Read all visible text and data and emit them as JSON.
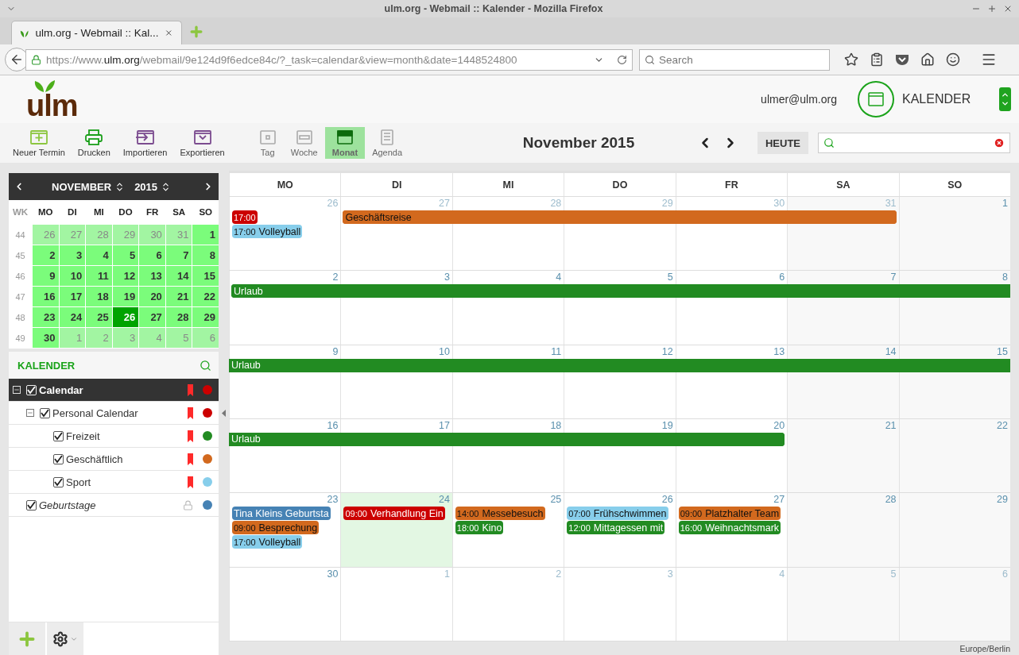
{
  "browser": {
    "window_title": "ulm.org - Webmail :: Kalender - Mozilla Firefox",
    "tab_title": "ulm.org - Webmail :: Kal...",
    "url": {
      "scheme": "https://www.",
      "domain": "ulm.org",
      "path": "/webmail/9e124d9f6edce84c/?_task=calendar&view=month&date=1448524800"
    },
    "search": {
      "placeholder": "Search"
    }
  },
  "header": {
    "logo": "ulm",
    "user": "ulmer@ulm.org",
    "app": "KALENDER"
  },
  "toolbar": {
    "actions": [
      {
        "label": "Neuer Termin"
      },
      {
        "label": "Drucken"
      },
      {
        "label": "Importieren"
      },
      {
        "label": "Exportieren"
      }
    ],
    "views": [
      {
        "label": "Tag",
        "selected": false
      },
      {
        "label": "Woche",
        "selected": false
      },
      {
        "label": "Monat",
        "selected": true
      },
      {
        "label": "Agenda",
        "selected": false
      }
    ],
    "title": "November 2015",
    "today": "HEUTE"
  },
  "mini_calendar": {
    "month": "NOVEMBER",
    "year": "2015",
    "headings": [
      "WK",
      "MO",
      "DI",
      "MI",
      "DO",
      "FR",
      "SA",
      "SO"
    ],
    "weeks": [
      {
        "number": "44",
        "days": [
          {
            "label": "26",
            "other_month": true,
            "selected": false
          },
          {
            "label": "27",
            "other_month": true,
            "selected": false
          },
          {
            "label": "28",
            "other_month": true,
            "selected": false
          },
          {
            "label": "29",
            "other_month": true,
            "selected": false
          },
          {
            "label": "30",
            "other_month": true,
            "selected": false
          },
          {
            "label": "31",
            "other_month": true,
            "selected": false
          },
          {
            "label": "1",
            "other_month": false,
            "selected": false
          }
        ]
      },
      {
        "number": "45",
        "days": [
          {
            "label": "2",
            "other_month": false,
            "selected": false
          },
          {
            "label": "3",
            "other_month": false,
            "selected": false
          },
          {
            "label": "4",
            "other_month": false,
            "selected": false
          },
          {
            "label": "5",
            "other_month": false,
            "selected": false
          },
          {
            "label": "6",
            "other_month": false,
            "selected": false
          },
          {
            "label": "7",
            "other_month": false,
            "selected": false
          },
          {
            "label": "8",
            "other_month": false,
            "selected": false
          }
        ]
      },
      {
        "number": "46",
        "days": [
          {
            "label": "9",
            "other_month": false,
            "selected": false
          },
          {
            "label": "10",
            "other_month": false,
            "selected": false
          },
          {
            "label": "11",
            "other_month": false,
            "selected": false
          },
          {
            "label": "12",
            "other_month": false,
            "selected": false
          },
          {
            "label": "13",
            "other_month": false,
            "selected": false
          },
          {
            "label": "14",
            "other_month": false,
            "selected": false
          },
          {
            "label": "15",
            "other_month": false,
            "selected": false
          }
        ]
      },
      {
        "number": "47",
        "days": [
          {
            "label": "16",
            "other_month": false,
            "selected": false
          },
          {
            "label": "17",
            "other_month": false,
            "selected": false
          },
          {
            "label": "18",
            "other_month": false,
            "selected": false
          },
          {
            "label": "19",
            "other_month": false,
            "selected": false
          },
          {
            "label": "20",
            "other_month": false,
            "selected": false
          },
          {
            "label": "21",
            "other_month": false,
            "selected": false
          },
          {
            "label": "22",
            "other_month": false,
            "selected": false
          }
        ]
      },
      {
        "number": "48",
        "days": [
          {
            "label": "23",
            "other_month": false,
            "selected": false
          },
          {
            "label": "24",
            "other_month": false,
            "selected": false
          },
          {
            "label": "25",
            "other_month": false,
            "selected": false
          },
          {
            "label": "26",
            "other_month": false,
            "selected": true
          },
          {
            "label": "27",
            "other_month": false,
            "selected": false
          },
          {
            "label": "28",
            "other_month": false,
            "selected": false
          },
          {
            "label": "29",
            "other_month": false,
            "selected": false
          }
        ]
      },
      {
        "number": "49",
        "days": [
          {
            "label": "30",
            "other_month": false,
            "selected": false
          },
          {
            "label": "1",
            "other_month": true,
            "selected": false
          },
          {
            "label": "2",
            "other_month": true,
            "selected": false
          },
          {
            "label": "3",
            "other_month": true,
            "selected": false
          },
          {
            "label": "4",
            "other_month": true,
            "selected": false
          },
          {
            "label": "5",
            "other_month": true,
            "selected": false
          },
          {
            "label": "6",
            "other_month": true,
            "selected": false
          }
        ]
      }
    ]
  },
  "calendars": {
    "title": "KALENDER",
    "items": [
      {
        "name": "Calendar",
        "kind": "writable",
        "checked": true,
        "selected": true,
        "expanded": true,
        "color": "#cc0000",
        "children": [
          {
            "name": "Personal Calendar",
            "kind": "writable",
            "checked": true,
            "selected": false,
            "expanded": true,
            "color": "#cc0000",
            "children": [
              {
                "name": "Freizeit",
                "kind": "writable",
                "checked": true,
                "selected": false,
                "color": "#228b22"
              },
              {
                "name": "Geschäftlich",
                "kind": "writable",
                "checked": true,
                "selected": false,
                "color": "#d2691e"
              },
              {
                "name": "Sport",
                "kind": "writable",
                "checked": true,
                "selected": false,
                "color": "#87ceeb"
              }
            ]
          }
        ]
      },
      {
        "name": "Geburtstage",
        "kind": "readonly",
        "checked": true,
        "selected": false,
        "color": "#4682b4"
      }
    ]
  },
  "month": {
    "headings": [
      "MO",
      "DI",
      "MI",
      "DO",
      "FR",
      "SA",
      "SO"
    ],
    "weeks": [
      {
        "days": [
          {
            "label": "26",
            "other_month": true,
            "today": false,
            "events": [
              {
                "time": "17:00",
                "color": "#cc0000"
              },
              {
                "time": "17:00",
                "title": "Volleyball",
                "color": "#87ceeb"
              }
            ]
          },
          {
            "label": "27",
            "other_month": true,
            "today": false
          },
          {
            "label": "28",
            "other_month": true,
            "today": false
          },
          {
            "label": "29",
            "other_month": true,
            "today": false
          },
          {
            "label": "30",
            "other_month": true,
            "today": false
          },
          {
            "label": "31",
            "other_month": true,
            "today": false
          },
          {
            "label": "1",
            "other_month": false,
            "today": false
          }
        ],
        "bars": [
          {
            "title": "Geschäftsreise",
            "color": "#d2691e",
            "covers": [
              false,
              true,
              true,
              true,
              true,
              true,
              false
            ],
            "starts_before": false,
            "ends_after": false
          }
        ]
      },
      {
        "days": [
          {
            "label": "2",
            "other_month": false,
            "today": false
          },
          {
            "label": "3",
            "other_month": false,
            "today": false
          },
          {
            "label": "4",
            "other_month": false,
            "today": false
          },
          {
            "label": "5",
            "other_month": false,
            "today": false
          },
          {
            "label": "6",
            "other_month": false,
            "today": false
          },
          {
            "label": "7",
            "other_month": false,
            "today": false
          },
          {
            "label": "8",
            "other_month": false,
            "today": false
          }
        ],
        "bars": [
          {
            "title": "Urlaub",
            "color": "#228b22",
            "covers": [
              true,
              true,
              true,
              true,
              true,
              true,
              true
            ],
            "starts_before": false,
            "ends_after": true
          }
        ]
      },
      {
        "days": [
          {
            "label": "9",
            "other_month": false,
            "today": false
          },
          {
            "label": "10",
            "other_month": false,
            "today": false
          },
          {
            "label": "11",
            "other_month": false,
            "today": false
          },
          {
            "label": "12",
            "other_month": false,
            "today": false
          },
          {
            "label": "13",
            "other_month": false,
            "today": false
          },
          {
            "label": "14",
            "other_month": false,
            "today": false
          },
          {
            "label": "15",
            "other_month": false,
            "today": false
          }
        ],
        "bars": [
          {
            "title": "Urlaub",
            "color": "#228b22",
            "covers": [
              true,
              true,
              true,
              true,
              true,
              true,
              true
            ],
            "starts_before": true,
            "ends_after": true
          }
        ]
      },
      {
        "days": [
          {
            "label": "16",
            "other_month": false,
            "today": false
          },
          {
            "label": "17",
            "other_month": false,
            "today": false
          },
          {
            "label": "18",
            "other_month": false,
            "today": false
          },
          {
            "label": "19",
            "other_month": false,
            "today": false
          },
          {
            "label": "20",
            "other_month": false,
            "today": false
          },
          {
            "label": "21",
            "other_month": false,
            "today": false
          },
          {
            "label": "22",
            "other_month": false,
            "today": false
          }
        ],
        "bars": [
          {
            "title": "Urlaub",
            "color": "#228b22",
            "covers": [
              true,
              true,
              true,
              true,
              true,
              false,
              false
            ],
            "starts_before": true,
            "ends_after": false
          }
        ]
      },
      {
        "days": [
          {
            "label": "23",
            "other_month": false,
            "today": false,
            "events": [
              {
                "title": "Tina Kleins Geburtsta",
                "color": "#4682b4"
              },
              {
                "time": "09:00",
                "title": "Besprechung",
                "color": "#d2691e"
              },
              {
                "time": "17:00",
                "title": "Volleyball",
                "color": "#87ceeb"
              }
            ]
          },
          {
            "label": "24",
            "other_month": false,
            "today": true,
            "events": [
              {
                "time": "09:00",
                "title": "Verhandlung Ein",
                "color": "#cc0000"
              }
            ]
          },
          {
            "label": "25",
            "other_month": false,
            "today": false,
            "events": [
              {
                "time": "14:00",
                "title": "Messebesuch",
                "color": "#d2691e"
              },
              {
                "time": "18:00",
                "title": "Kino",
                "color": "#228b22"
              }
            ]
          },
          {
            "label": "26",
            "other_month": false,
            "today": false,
            "events": [
              {
                "time": "07:00",
                "title": "Frühschwimmen",
                "color": "#87ceeb"
              },
              {
                "time": "12:00",
                "title": "Mittagessen mit",
                "color": "#228b22"
              }
            ]
          },
          {
            "label": "27",
            "other_month": false,
            "today": false,
            "events": [
              {
                "time": "09:00",
                "title": "Platzhalter Team",
                "color": "#d2691e"
              },
              {
                "time": "16:00",
                "title": "Weihnachtsmark",
                "color": "#228b22"
              }
            ]
          },
          {
            "label": "28",
            "other_month": false,
            "today": false
          },
          {
            "label": "29",
            "other_month": false,
            "today": false
          }
        ]
      },
      {
        "days": [
          {
            "label": "30",
            "other_month": false,
            "today": false
          },
          {
            "label": "1",
            "other_month": true,
            "today": false
          },
          {
            "label": "2",
            "other_month": true,
            "today": false
          },
          {
            "label": "3",
            "other_month": true,
            "today": false
          },
          {
            "label": "4",
            "other_month": true,
            "today": false
          },
          {
            "label": "5",
            "other_month": true,
            "today": false
          },
          {
            "label": "6",
            "other_month": true,
            "today": false
          }
        ]
      }
    ]
  },
  "status": "Europe/Berlin"
}
